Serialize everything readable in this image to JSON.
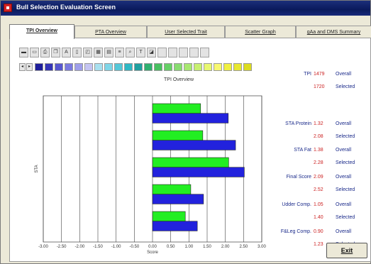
{
  "window": {
    "title": "Bull Selection Evaluation Screen"
  },
  "tabs": [
    {
      "label": "TPI Overview",
      "active": true
    },
    {
      "label": "PTA Overview",
      "active": false
    },
    {
      "label": "User Selected Trait",
      "active": false
    },
    {
      "label": "Scatter Graph",
      "active": false
    },
    {
      "label": "gAa and DMS Summary",
      "active": false
    }
  ],
  "toolbar": {
    "icons": [
      "chart-bar-icon",
      "print-icon",
      "printer-icon",
      "copy-icon",
      "text-icon",
      "label-icon",
      "area-icon",
      "grid-icon",
      "grid-2-icon",
      "data-icon",
      "search-icon",
      "title-icon",
      "palette-icon",
      "blank-icon",
      "blank-icon",
      "blank-icon",
      "blank-icon",
      "blank-icon"
    ]
  },
  "palette": {
    "colors": [
      "#1e1e9c",
      "#3535b8",
      "#5757d0",
      "#7a7ae0",
      "#9e9eea",
      "#c4c4f2",
      "#a8e0f0",
      "#7fd6e8",
      "#55c8d8",
      "#2fb8c4",
      "#20a0a0",
      "#30b070",
      "#48c060",
      "#66d066",
      "#88dc70",
      "#a8e870",
      "#c8f070",
      "#e8f870",
      "#f8f870",
      "#f0f040",
      "#e8e830",
      "#dcdc20"
    ]
  },
  "chart_data": {
    "type": "bar",
    "orientation": "horizontal",
    "title": "TPI Overview",
    "ylabel": "STA",
    "xlabel": "Score",
    "x_ticks": [
      "-3.00",
      "-2.50",
      "-2.00",
      "-1.50",
      "-1.00",
      "-0.50",
      "0.00",
      "0.50",
      "1.00",
      "1.50",
      "2.00",
      "2.50",
      "3.00"
    ],
    "xlim": [
      -3,
      3
    ],
    "categories": [
      "STA Protein",
      "STA Fat",
      "Final Score",
      "Udder Comp.",
      "F&Leg Comp."
    ],
    "series": [
      {
        "name": "Overall",
        "color": "#22ee22",
        "values": [
          1.32,
          1.38,
          2.09,
          1.05,
          0.9
        ]
      },
      {
        "name": "Selected",
        "color": "#2222dd",
        "values": [
          2.08,
          2.28,
          2.52,
          1.4,
          1.23
        ]
      }
    ],
    "grid": true
  },
  "stats": {
    "tpi": {
      "label": "TPI",
      "overall": "1479",
      "selected": "1720"
    },
    "items": [
      {
        "label": "STA Protein",
        "overall": "1.32",
        "selected": "2.08"
      },
      {
        "label": "STA Fat",
        "overall": "1.38",
        "selected": "2.28"
      },
      {
        "label": "Final Score",
        "overall": "2.09",
        "selected": "2.52"
      },
      {
        "label": "Udder Comp.",
        "overall": "1.05",
        "selected": "1.40"
      },
      {
        "label": "F&Leg Comp.",
        "overall": "0.90",
        "selected": "1.23"
      }
    ],
    "overall_word": "Overall",
    "selected_word": "Selected"
  },
  "exit_button": {
    "label": "Exit"
  }
}
